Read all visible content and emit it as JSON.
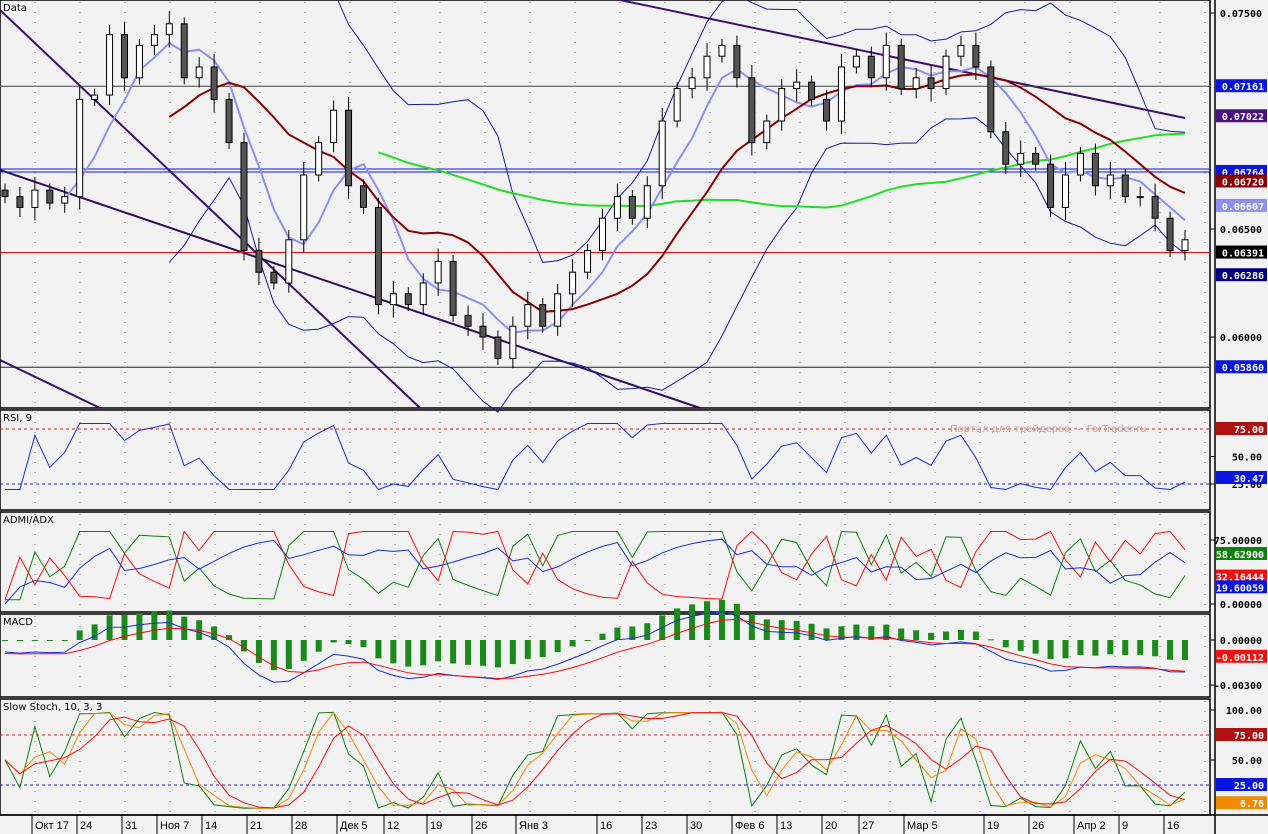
{
  "panels": {
    "main": "Data",
    "rsi": "RSI, 9",
    "adx": "ADMI/ADX",
    "macd": "MACD",
    "stoch": "Slow Stoch, 10, 3, 3"
  },
  "watermark": "Портал для трейдеров — ForTrader.ru",
  "x_labels": [
    "Окт 17",
    "24",
    "31",
    "Ноя 7",
    "14",
    "21",
    "28",
    "Дек 5",
    "12",
    "19",
    "26",
    "Янв 3",
    "16",
    "23",
    "30",
    "Фев 6",
    "13",
    "20",
    "27",
    "Мар 5",
    "19",
    "26",
    "Апр 2",
    "9",
    "16"
  ],
  "axis": {
    "main_ticks": [
      "0.07500",
      "0.06500",
      "0.06000"
    ],
    "main_badges": [
      {
        "text": "0.07161",
        "color": "#0a14e0",
        "value": 0.07161
      },
      {
        "text": "0.07022",
        "color": "#4b1182",
        "value": 0.07022
      },
      {
        "text": "0.06764",
        "color": "#0a14e0",
        "value": 0.06764
      },
      {
        "text": "0.06720",
        "color": "#8b0000",
        "value": 0.0672
      },
      {
        "text": "0.06607",
        "color": "#8c90f0",
        "value": 0.06607
      },
      {
        "text": "0.06391",
        "color": "#000000",
        "value": 0.06391
      },
      {
        "text": "0.06286",
        "color": "#000080",
        "value": 0.06286
      },
      {
        "text": "0.05860",
        "color": "#0a14e0",
        "value": 0.0586
      }
    ],
    "rsi_ticks": [
      "50.00",
      "25.00"
    ],
    "rsi_badges": [
      {
        "text": "75.00",
        "color": "#b01010",
        "value": 75
      },
      {
        "text": "30.47",
        "color": "#0a14e0",
        "value": 30.47
      }
    ],
    "adx_ticks": [
      "75.00000",
      "0.00000"
    ],
    "adx_badges": [
      {
        "text": "58.62900",
        "color": "#108010",
        "value": 58.629
      },
      {
        "text": "32.16444",
        "color": "#f01010",
        "value": 32.16444
      },
      {
        "text": "19.60059",
        "color": "#0a14e0",
        "value": 19.60059
      }
    ],
    "macd_ticks": [
      "0.00000",
      "-0.00300"
    ],
    "macd_badges": [
      {
        "text": "-0.00112",
        "color": "#f01010",
        "value": -0.00112
      }
    ],
    "stoch_ticks": [
      "100.00",
      "50.00"
    ],
    "stoch_badges": [
      {
        "text": "75.00",
        "color": "#b01010",
        "value": 75
      },
      {
        "text": "25.00",
        "color": "#0a14e0",
        "value": 25
      },
      {
        "text": "6.76",
        "color": "#f08a00",
        "value": 6.76
      }
    ]
  },
  "chart_data": {
    "type": "candlestick",
    "title": "Data",
    "ylim": [
      0.0555,
      0.0762
    ],
    "hlines": [
      {
        "value": 0.07161,
        "color": "#444"
      },
      {
        "value": 0.06764,
        "color": "#0a14e0"
      },
      {
        "value": 0.06391,
        "color": "#e01010"
      },
      {
        "value": 0.0586,
        "color": "#222"
      }
    ],
    "close": [
      0.0665,
      0.066,
      0.0668,
      0.0662,
      0.0665,
      0.071,
      0.0712,
      0.074,
      0.072,
      0.0735,
      0.074,
      0.0745,
      0.072,
      0.0725,
      0.071,
      0.069,
      0.064,
      0.063,
      0.0625,
      0.0645,
      0.0675,
      0.069,
      0.0705,
      0.067,
      0.066,
      0.0615,
      0.062,
      0.0615,
      0.0625,
      0.0635,
      0.061,
      0.0605,
      0.06,
      0.059,
      0.0605,
      0.0615,
      0.0605,
      0.062,
      0.063,
      0.064,
      0.0655,
      0.0665,
      0.0655,
      0.067,
      0.07,
      0.0715,
      0.072,
      0.073,
      0.0735,
      0.072,
      0.069,
      0.07,
      0.0715,
      0.0718,
      0.071,
      0.07,
      0.0725,
      0.073,
      0.072,
      0.0735,
      0.0715,
      0.072,
      0.0715,
      0.073,
      0.0735,
      0.0725,
      0.0695,
      0.068,
      0.0685,
      0.068,
      0.066,
      0.0675,
      0.0685,
      0.067,
      0.0675,
      0.0665,
      0.0665,
      0.0655,
      0.064,
      0.0645
    ],
    "rsi_levels": [
      75,
      25
    ],
    "stoch_levels": [
      75,
      25
    ]
  }
}
